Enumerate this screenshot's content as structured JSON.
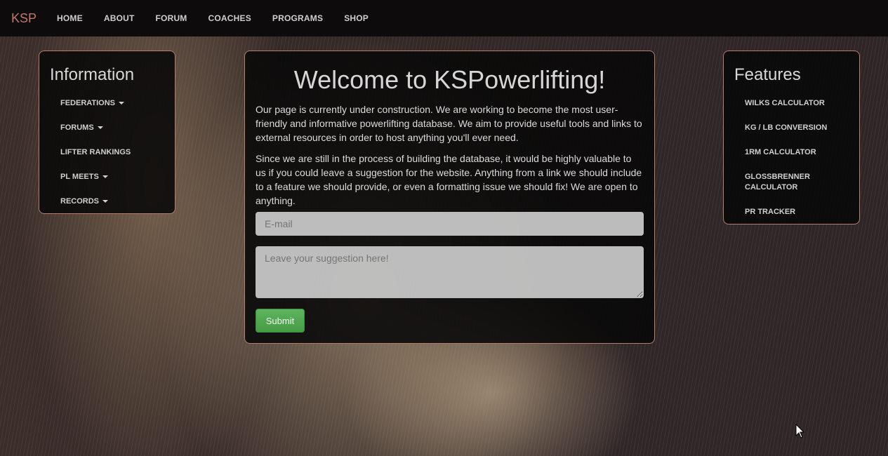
{
  "nav": {
    "brand": "KSP",
    "links": [
      "HOME",
      "ABOUT",
      "FORUM",
      "COACHES",
      "PROGRAMS",
      "SHOP"
    ]
  },
  "info": {
    "title": "Information",
    "items": [
      {
        "label": "FEDERATIONS",
        "dropdown": true
      },
      {
        "label": "FORUMS",
        "dropdown": true
      },
      {
        "label": "LIFTER RANKINGS",
        "dropdown": false
      },
      {
        "label": "PL MEETS",
        "dropdown": true
      },
      {
        "label": "RECORDS",
        "dropdown": true
      }
    ]
  },
  "features": {
    "title": "Features",
    "items": [
      "WILKS CALCULATOR",
      "KG / LB CONVERSION",
      "1RM CALCULATOR",
      "GLOSSBRENNER CALCULATOR",
      "PR TRACKER"
    ]
  },
  "main": {
    "title": "Welcome to KSPowerlifting!",
    "paragraph1": "Our page is currently under construction. We are working to become the most user-friendly and informative powerlifting database. We aim to provide useful tools and links to external resources in order to host anything you'll ever need.",
    "paragraph2": "Since we are still in the process of building the database, it would be highly valuable to us if you could leave a suggestion for the website. Anything from a link we should include to a feature we should provide, or even a formatting issue we should fix! We are open to anything.",
    "email_placeholder": "E-mail",
    "suggestion_placeholder": "Leave your suggestion here!",
    "submit_label": "Submit"
  },
  "colors": {
    "brand": "#c4786a",
    "panel_border": "#b77d6d",
    "submit": "#4cae4c"
  }
}
